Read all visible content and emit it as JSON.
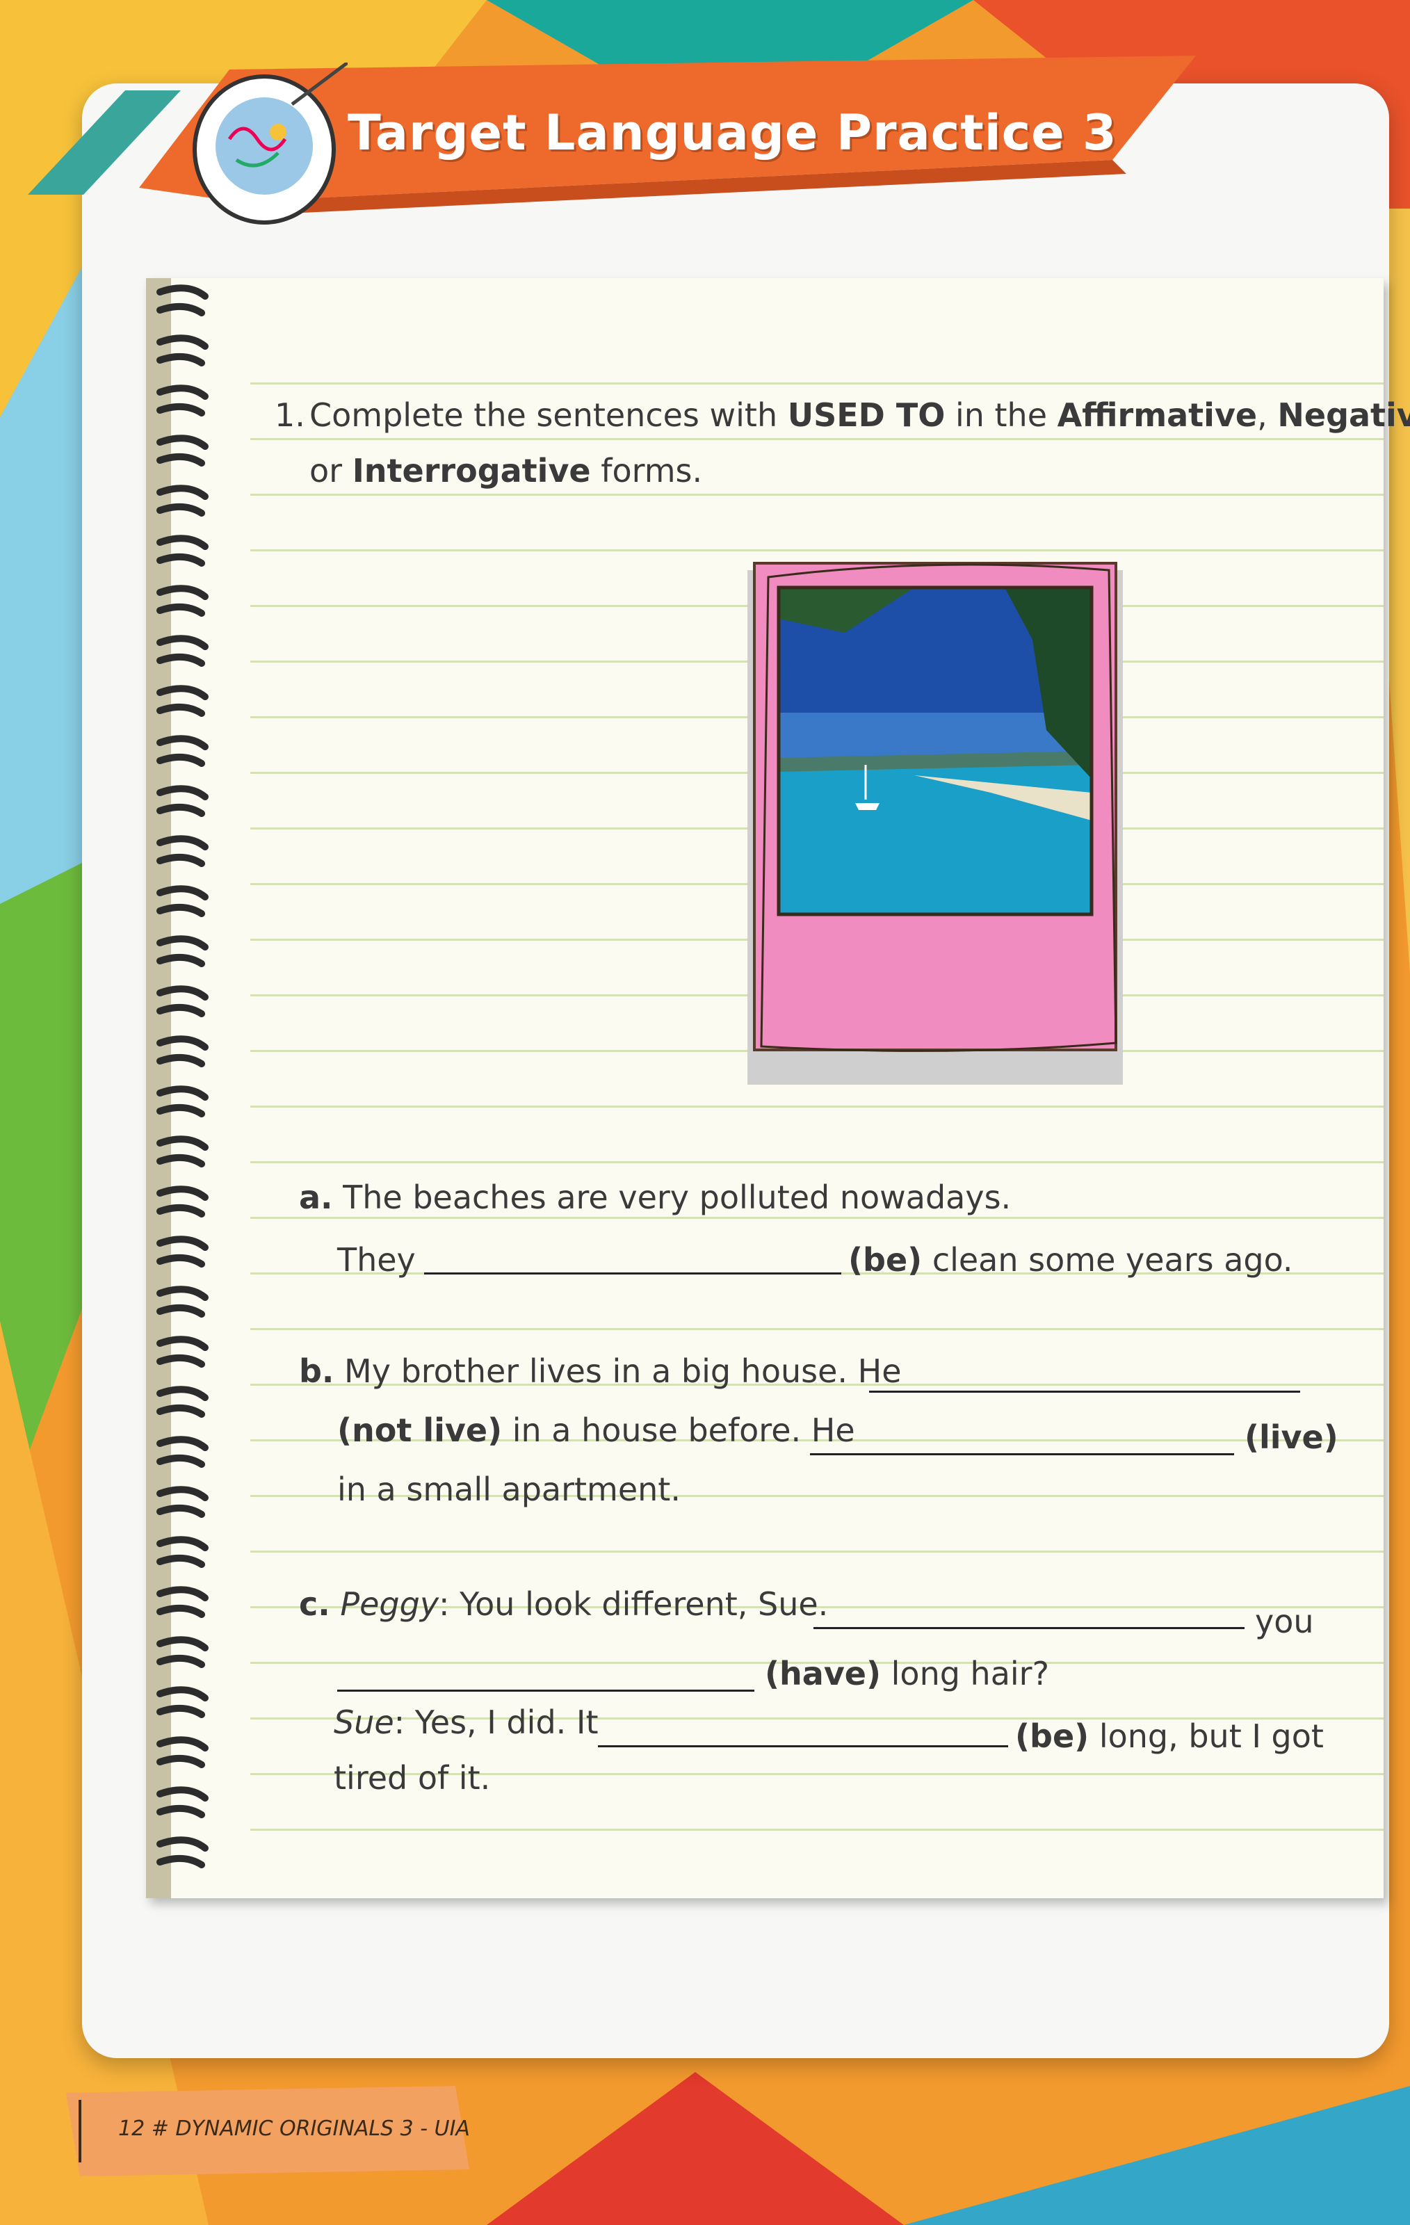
{
  "header": {
    "title": "Target Language Practice 3"
  },
  "exercise": {
    "instruction_number": "1.",
    "instruction_parts": [
      "Complete the sentences with ",
      "USED TO",
      " in the ",
      "Affirmative",
      ", ",
      "Negative",
      " or ",
      "Interrogative",
      " forms."
    ],
    "a": {
      "letter": "a.",
      "line1": "The beaches are very polluted nowadays.",
      "line2_start": "They",
      "verb": "(be)",
      "line2_end": "clean some years ago."
    },
    "b": {
      "letter": "b.",
      "line1": "My brother lives in a big house. He",
      "verb1": "(not live)",
      "line2_mid": "in a house before. He",
      "verb2": "(live)",
      "line3": "in a small apartment."
    },
    "c": {
      "letter": "c.",
      "speaker1": "Peggy",
      "line1": ": You look different, Sue.",
      "you": "you",
      "verb1": "(have)",
      "line2_end": "long hair?",
      "speaker2": "Sue",
      "line3": ": Yes, I did. It",
      "verb2": "(be)",
      "line3_end": "long, but I got",
      "line4": "tired of it."
    }
  },
  "footer": {
    "page_label": "12 # DYNAMIC ORIGINALS 3 - UIA"
  },
  "colors": {
    "banner_orange": "#ee6a2c",
    "banner_teal": "#3aa59b",
    "photo_frame_pink": "#f08cc0"
  },
  "icons": {
    "badge": "doodle-badge-icon",
    "photo": "beach-photo"
  }
}
